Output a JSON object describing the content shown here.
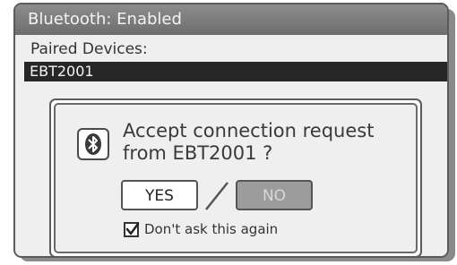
{
  "window": {
    "title": "Bluetooth: Enabled"
  },
  "paired": {
    "label": "Paired Devices:",
    "devices": [
      "EBT2001"
    ]
  },
  "dialog": {
    "icon": "bluetooth-icon",
    "message_line1": "Accept connection request",
    "message_line2": "from EBT2001 ?",
    "yes_label": "YES",
    "no_label": "NO",
    "checkbox_label": "Don't ask this again",
    "checkbox_checked": true
  },
  "colors": {
    "titlebar": "#7d7d7d",
    "selected_row": "#262626",
    "panel": "#efefef",
    "no_button": "#9c9c9c"
  }
}
